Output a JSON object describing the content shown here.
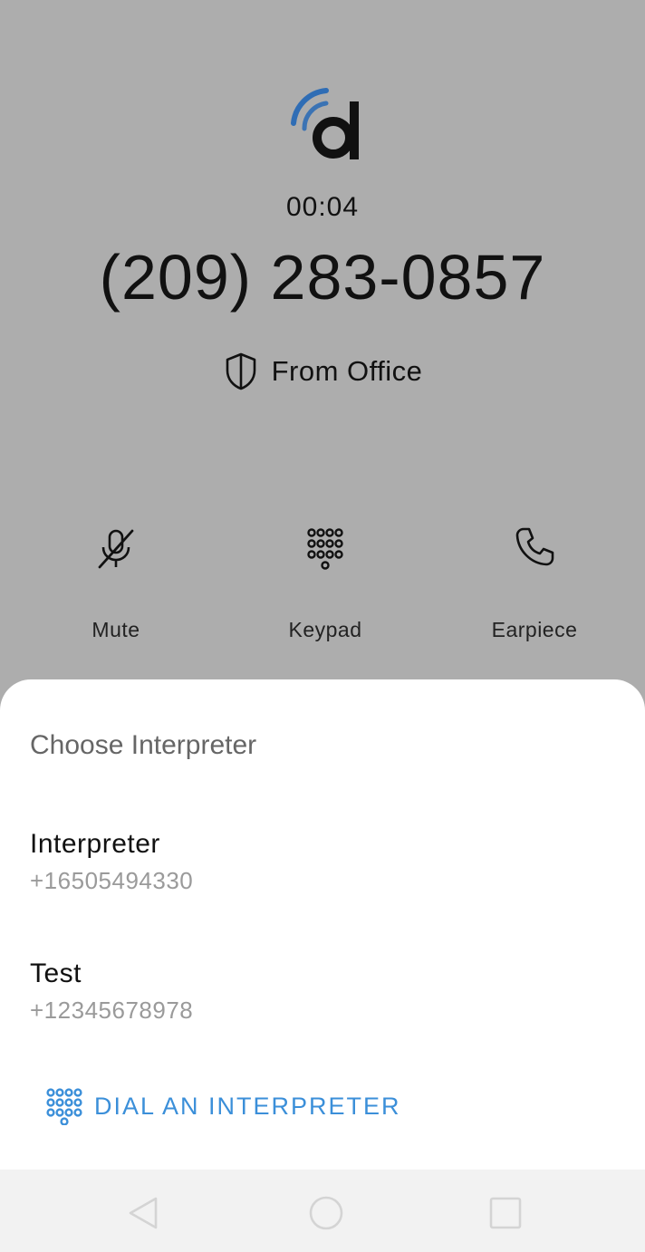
{
  "call": {
    "timer": "00:04",
    "number": "(209) 283-0857",
    "caller_id_label": "From Office"
  },
  "controls": {
    "mute_label": "Mute",
    "keypad_label": "Keypad",
    "earpiece_label": "Earpiece"
  },
  "sheet": {
    "title": "Choose Interpreter",
    "interpreters": [
      {
        "name": "Interpreter",
        "phone": "+16505494330"
      },
      {
        "name": "Test",
        "phone": "+12345678978"
      }
    ],
    "dial_label": "DIAL AN INTERPRETER"
  },
  "icons": {
    "logo": "dialpad-logo-icon",
    "caller_id": "shield-icon",
    "mute": "mic-off-icon",
    "keypad": "dialpad-icon",
    "earpiece": "phone-icon",
    "dial": "dialpad-icon"
  },
  "colors": {
    "background": "#adadad",
    "accent": "#3b8fd9",
    "logo_blue": "#2f6db5"
  }
}
